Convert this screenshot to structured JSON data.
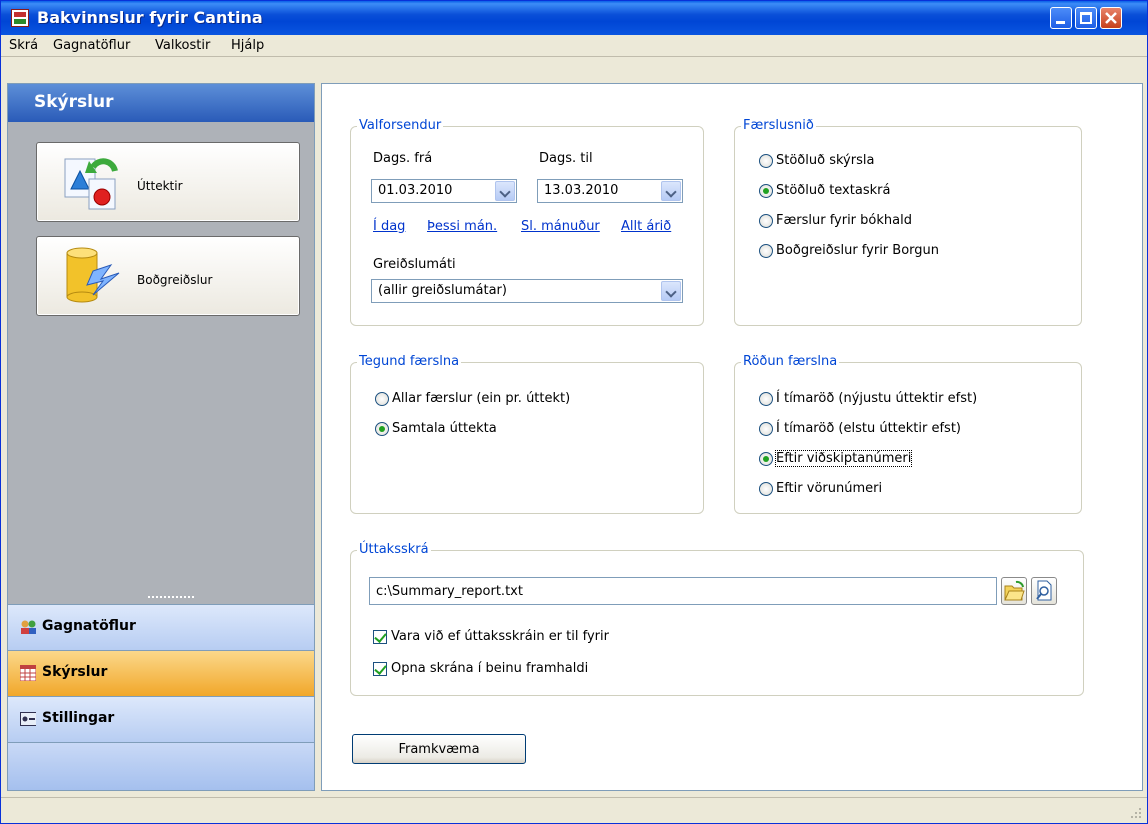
{
  "window": {
    "title": "Bakvinnslur fyrir Cantina"
  },
  "menu": {
    "items": [
      "Skrá",
      "Gagnatöflur",
      "Valkostir",
      "Hjálp"
    ]
  },
  "sidebar": {
    "header": "Skýrslur",
    "buttons": [
      {
        "label": "Úttektir",
        "icon": "shapes-refresh-icon"
      },
      {
        "label": "Boðgreiðslur",
        "icon": "database-lightning-icon"
      }
    ],
    "nav": [
      {
        "label": "Gagnatöflur",
        "icon": "people-icon",
        "active": false
      },
      {
        "label": "Skýrslur",
        "icon": "table-icon",
        "active": true
      },
      {
        "label": "Stillingar",
        "icon": "settings-icon",
        "active": false
      }
    ]
  },
  "valforsendur": {
    "title": "Valforsendur",
    "date_from_label": "Dags. frá",
    "date_from": "01.03.2010",
    "date_to_label": "Dags. til",
    "date_to": "13.03.2010",
    "links": [
      "Í dag",
      "Þessi mán.",
      "Sl. mánuður",
      "Allt árið"
    ],
    "payment_label": "Greiðslumáti",
    "payment_value": "(allir greiðslumátar)"
  },
  "faerslusnid": {
    "title": "Færslusnið",
    "options": [
      "Stöðluð skýrsla",
      "Stöðluð textaskrá",
      "Færslur fyrir bókhald",
      "Boðgreiðslur fyrir Borgun"
    ],
    "selected": 1
  },
  "tegund": {
    "title": "Tegund færslna",
    "options": [
      "Allar færslur (ein pr. úttekt)",
      "Samtala úttekta"
    ],
    "selected": 1
  },
  "rodun": {
    "title": "Röðun færslna",
    "options": [
      "Í tímaröð (nýjustu úttektir efst)",
      "Í tímaröð (elstu úttektir efst)",
      "Eftir viðskiptanúmeri",
      "Eftir vörunúmeri"
    ],
    "selected": 2
  },
  "uttaksskra": {
    "title": "Úttaksskrá",
    "path": "c:\\Summary_report.txt",
    "check1": "Vara við ef úttaksskráin er til fyrir",
    "check2": "Opna skrána í beinu framhaldi"
  },
  "action": {
    "label": "Framkvæma"
  }
}
